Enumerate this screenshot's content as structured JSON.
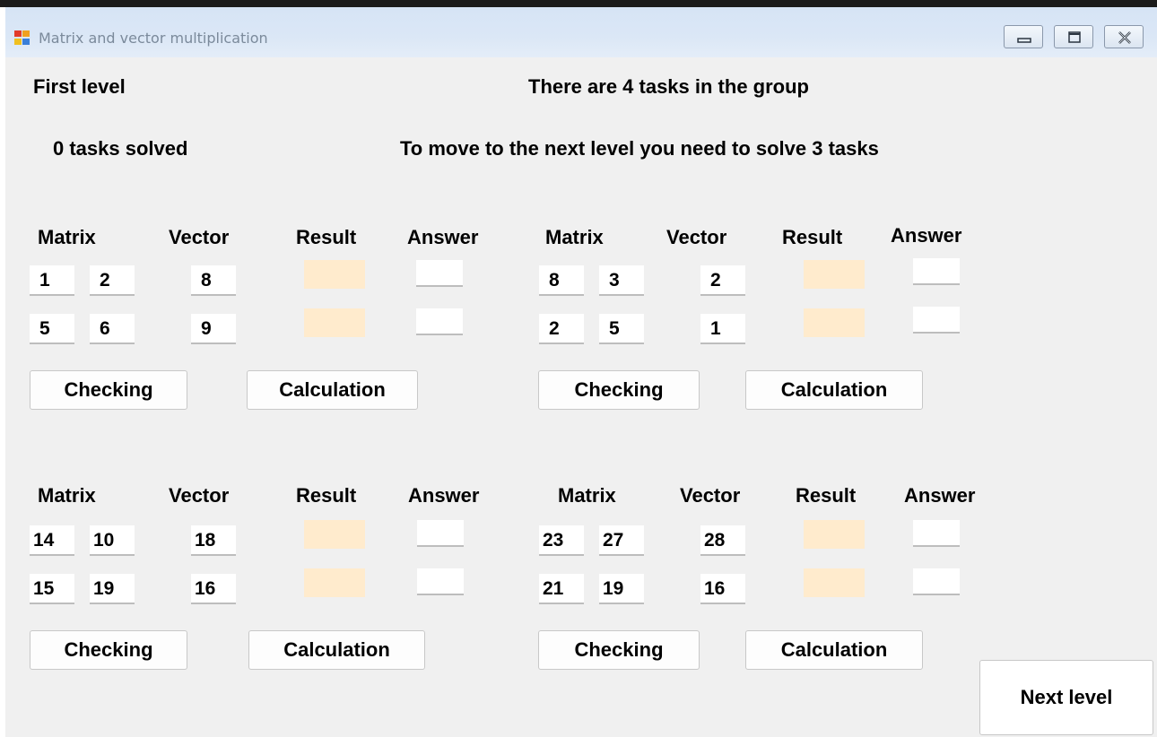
{
  "window": {
    "title": "Matrix and vector multiplication",
    "controls": {
      "minimize_icon": "minimize-icon",
      "maximize_icon": "maximize-icon",
      "close_icon": "close-icon"
    }
  },
  "header": {
    "level": "First level",
    "tasks_in_group": "There are 4 tasks in the group",
    "solved": "0 tasks solved",
    "requirement": "To move to the next level you need to solve 3 tasks"
  },
  "labels": {
    "matrix": "Matrix",
    "vector": "Vector",
    "result": "Result",
    "answer": "Answer"
  },
  "buttons": {
    "check": "Checking",
    "calculate": "Calculation",
    "next_level": "Next level"
  },
  "tasks": [
    {
      "matrix": [
        [
          "1",
          "2"
        ],
        [
          "5",
          "6"
        ]
      ],
      "vector": [
        "8",
        "9"
      ],
      "result": [
        "",
        ""
      ],
      "answer": [
        "",
        ""
      ]
    },
    {
      "matrix": [
        [
          "8",
          "3"
        ],
        [
          "2",
          "5"
        ]
      ],
      "vector": [
        "2",
        "1"
      ],
      "result": [
        "",
        ""
      ],
      "answer": [
        "",
        ""
      ]
    },
    {
      "matrix": [
        [
          "14",
          "10"
        ],
        [
          "15",
          "19"
        ]
      ],
      "vector": [
        "18",
        "16"
      ],
      "result": [
        "",
        ""
      ],
      "answer": [
        "",
        ""
      ]
    },
    {
      "matrix": [
        [
          "23",
          "27"
        ],
        [
          "21",
          "19"
        ]
      ],
      "vector": [
        "28",
        "16"
      ],
      "result": [
        "",
        ""
      ],
      "answer": [
        "",
        ""
      ]
    }
  ],
  "colors": {
    "result_fill": "#ffebcd",
    "window_bg": "#f0f0f0"
  }
}
